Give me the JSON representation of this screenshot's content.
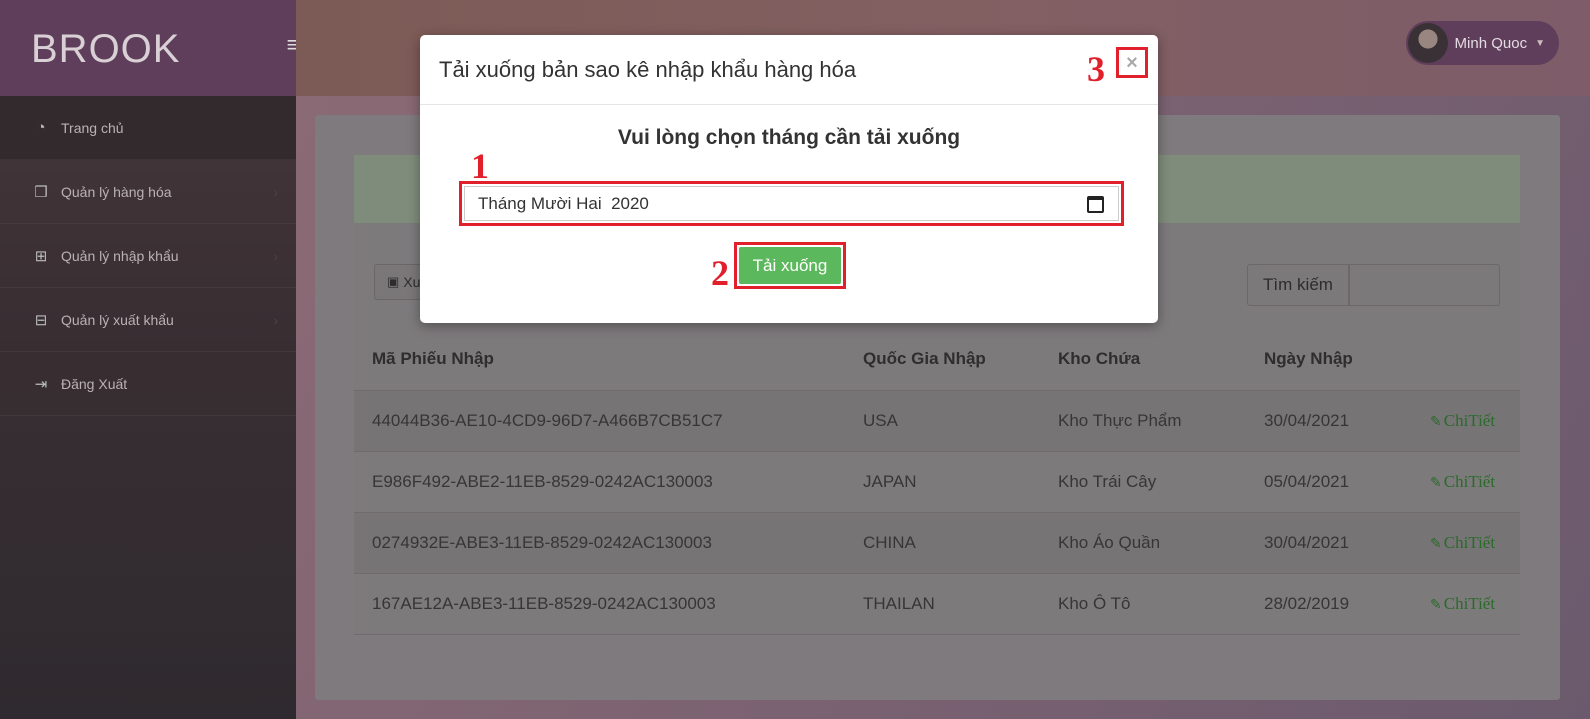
{
  "brand": "BROOK",
  "user": {
    "name": "Minh Quoc"
  },
  "sidebar": {
    "items": [
      {
        "label": "Trang chủ",
        "icon": "dashboard-icon"
      },
      {
        "label": "Quản lý hàng hóa",
        "icon": "cubes-icon"
      },
      {
        "label": "Quản lý nhập khẩu",
        "icon": "plus-square-icon"
      },
      {
        "label": "Quản lý xuất khẩu",
        "icon": "minus-square-icon"
      },
      {
        "label": "Đăng Xuất",
        "icon": "sign-out-icon"
      }
    ]
  },
  "toolbar": {
    "export_label": "Xu",
    "search_label": "Tìm kiếm"
  },
  "table": {
    "headers": [
      "Mã Phiếu Nhập",
      "Quốc Gia Nhập",
      "Kho Chứa",
      "Ngày Nhập"
    ],
    "detail_label": "ChiTiết",
    "rows": [
      {
        "id": "44044B36-AE10-4CD9-96D7-A466B7CB51C7",
        "country": "USA",
        "warehouse": "Kho Thực Phẩm",
        "date": "30/04/2021"
      },
      {
        "id": "E986F492-ABE2-11EB-8529-0242AC130003",
        "country": "JAPAN",
        "warehouse": "Kho Trái Cây",
        "date": "05/04/2021"
      },
      {
        "id": "0274932E-ABE3-11EB-8529-0242AC130003",
        "country": "CHINA",
        "warehouse": "Kho Áo Quần",
        "date": "30/04/2021"
      },
      {
        "id": "167AE12A-ABE3-11EB-8529-0242AC130003",
        "country": "THAILAN",
        "warehouse": "Kho Ô Tô",
        "date": "28/02/2019"
      }
    ]
  },
  "modal": {
    "title": "Tải xuống bản sao kê nhập khẩu hàng hóa",
    "heading": "Vui lòng chọn tháng cần tải xuống",
    "month_value": "Tháng Mười Hai  2020",
    "download_label": "Tải xuống",
    "close_symbol": "×",
    "steps": [
      "1",
      "2",
      "3"
    ]
  },
  "colors": {
    "annotation_red": "#e0202a",
    "download_green": "#5cb85c",
    "sidebar_purple": "#5e3e5a"
  }
}
